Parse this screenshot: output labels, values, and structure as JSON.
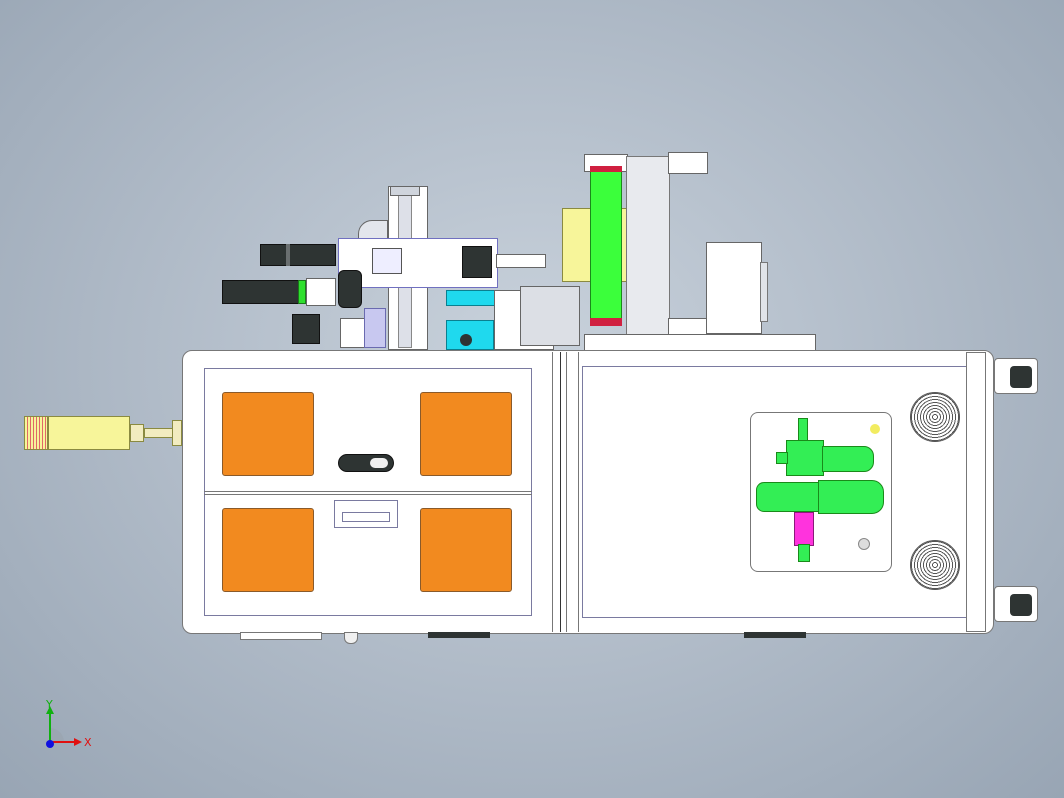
{
  "viewport": {
    "background": "#b3bdc9"
  },
  "colors": {
    "cabinet": "#ffffff",
    "door_panel": "#f28a1f",
    "roller": "#3bff3b",
    "housing": "#f7f59a",
    "cyan_block": "#1fd9ee",
    "valve_green": "#33ee55",
    "valve_magenta": "#ff33dd",
    "motor_dark": "#2e3433",
    "axis_x": "#e01010",
    "axis_y": "#10b010",
    "axis_z": "#1010e0"
  },
  "axis_triad": {
    "x_label": "X",
    "y_label": "Y"
  },
  "icons": [
    "fan-grille-icon",
    "caster-wheel-icon",
    "door-handle-icon",
    "axis-triad-icon"
  ]
}
